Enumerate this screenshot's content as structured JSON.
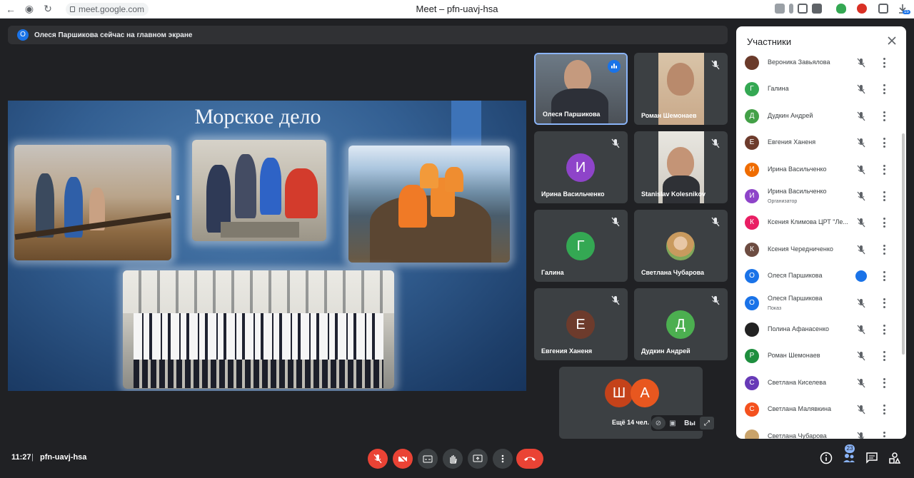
{
  "browser": {
    "url": "meet.google.com",
    "tab_title": "Meet – pfn-uavj-hsa",
    "download_badge": "15"
  },
  "banner": {
    "avatar_letter": "О",
    "text": "Олеся Паршикова сейчас на главном экране"
  },
  "presentation": {
    "title": "Морское дело"
  },
  "tiles": [
    {
      "name": "Олеся Паршикова",
      "letter": "",
      "color": "",
      "speaking": true
    },
    {
      "name": "Роман Шемонаев",
      "letter": "",
      "color": ""
    },
    {
      "name": "Ирина Васильченко",
      "letter": "И",
      "color": "#8e44c9"
    },
    {
      "name": "Stanislav Kolesnikov",
      "letter": "",
      "color": ""
    },
    {
      "name": "Галина",
      "letter": "Г",
      "color": "#34a853"
    },
    {
      "name": "Светлана Чубарова",
      "letter": "",
      "color": ""
    },
    {
      "name": "Евгения Ханеня",
      "letter": "Е",
      "color": "#6d3b2c"
    },
    {
      "name": "Дудкин Андрей",
      "letter": "Д",
      "color": "#4caf50"
    }
  ],
  "more": {
    "avatar1": "Ш",
    "avatar2": "А",
    "label": "Ещё 14 чел.",
    "you_label": "Вы"
  },
  "panel": {
    "title": "Участники",
    "participants": [
      {
        "name": "Вероника Завьялова",
        "letter": "",
        "color": "#6a3a2a",
        "sub": ""
      },
      {
        "name": "Галина",
        "letter": "Г",
        "color": "#34a853",
        "sub": ""
      },
      {
        "name": "Дудкин Андрей",
        "letter": "Д",
        "color": "#43a047",
        "sub": ""
      },
      {
        "name": "Евгения Ханеня",
        "letter": "Е",
        "color": "#6d3b2c",
        "sub": ""
      },
      {
        "name": "Ирина Васильченко",
        "letter": "И",
        "color": "#ef6c00",
        "sub": ""
      },
      {
        "name": "Ирина Васильченко",
        "letter": "И",
        "color": "#8e44c9",
        "sub": "Организатор"
      },
      {
        "name": "Ксения Климова ЦРТ \"Ле...",
        "letter": "К",
        "color": "#e91e63",
        "sub": ""
      },
      {
        "name": "Ксения Чередниченко",
        "letter": "К",
        "color": "#6d4c41",
        "sub": ""
      },
      {
        "name": "Олеся Паршикова",
        "letter": "О",
        "color": "#1a73e8",
        "sub": "",
        "speaking": true
      },
      {
        "name": "Олеся Паршикова",
        "letter": "О",
        "color": "#1a73e8",
        "sub": "Показ"
      },
      {
        "name": "Полина Афанасенко",
        "letter": "",
        "color": "#222222",
        "sub": ""
      },
      {
        "name": "Роман Шемонаев",
        "letter": "Р",
        "color": "#1e8e3e",
        "sub": ""
      },
      {
        "name": "Светлана Киселева",
        "letter": "С",
        "color": "#673ab7",
        "sub": ""
      },
      {
        "name": "Светлана Малявкина",
        "letter": "С",
        "color": "#f4511e",
        "sub": ""
      },
      {
        "name": "Светлана Чубарова",
        "letter": "",
        "color": "#c9a36b",
        "sub": ""
      }
    ]
  },
  "bottom": {
    "time": "11:27",
    "separator": "|",
    "meeting_code": "pfn-uavj-hsa",
    "people_count": "23"
  }
}
